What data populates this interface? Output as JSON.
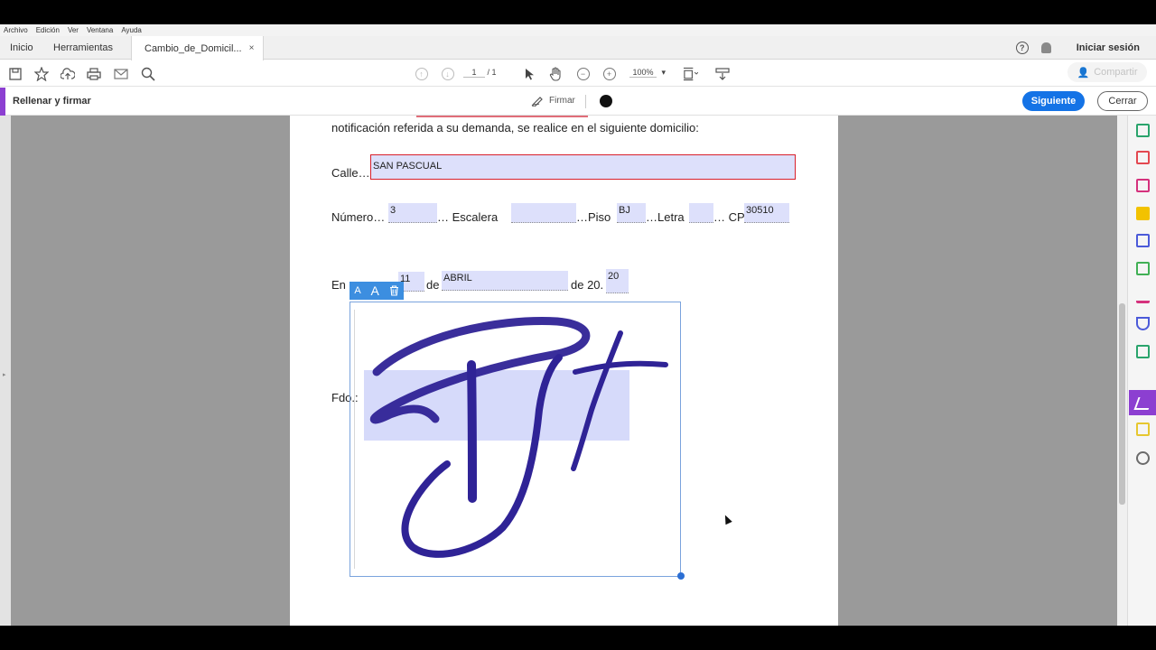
{
  "menu": [
    "Archivo",
    "Edición",
    "Ver",
    "Ventana",
    "Ayuda"
  ],
  "tabs": {
    "home": "Inicio",
    "tools": "Herramientas",
    "document": "Cambio_de_Domicil...",
    "close": "×"
  },
  "header": {
    "help": "?",
    "signin": "Iniciar sesión"
  },
  "toolbar": {
    "page_current": "1",
    "page_sep": "/",
    "page_total": "1",
    "zoom": "100%",
    "share": "Compartir"
  },
  "fillsign": {
    "title": "Rellenar y firmar",
    "sign": "Firmar",
    "next": "Siguiente",
    "close": "Cerrar"
  },
  "document": {
    "line1": "notificación referida a su demanda, se realice en el siguiente domicilio:",
    "calle_label": "Calle…",
    "calle_value": "SAN PASCUAL",
    "numero_label": "Número…",
    "numero_value": "3",
    "escalera_label": "… Escalera",
    "escalera_value": "",
    "piso_label": "…Piso",
    "piso_value": "BJ",
    "letra_label": "…Letra",
    "letra_value": "",
    "cp_label": "… CP.",
    "cp_value": "30510",
    "en_label": "En",
    "dia_value": "11",
    "de_label": "de",
    "mes_value": "ABRIL",
    "de20_label": "de 20.",
    "anio_value": "20",
    "fdo_label": "Fdo.:"
  },
  "signature_tools": {
    "small_text": "A",
    "large_text": "A"
  },
  "colors": {
    "accent": "#8c3fd1",
    "primary": "#1473e6",
    "field": "#dde0fb",
    "signature": "#2f2396"
  }
}
